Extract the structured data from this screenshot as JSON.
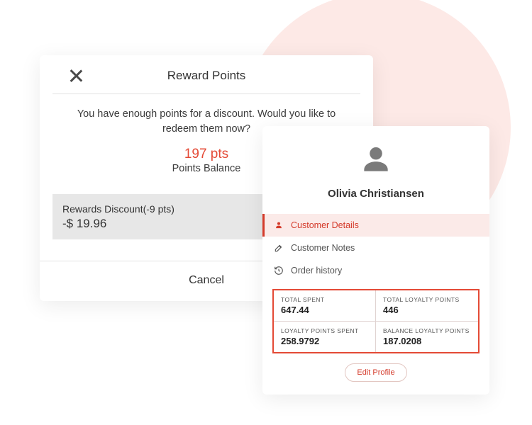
{
  "rewards": {
    "title": "Reward Points",
    "message": "You have enough points for a discount. Would you like to redeem them now?",
    "points_value": "197 pts",
    "points_label": "Points Balance",
    "discount_label": "Rewards Discount(-9 pts)",
    "discount_amount": "-$ 19.96",
    "cancel_label": "Cancel"
  },
  "customer": {
    "name": "Olivia Christiansen",
    "tabs": {
      "details": "Customer Details",
      "notes": "Customer Notes",
      "history": "Order history"
    },
    "stats": {
      "total_spent_label": "TOTAL SPENT",
      "total_spent_value": "647.44",
      "total_points_label": "TOTAL LOYALTY POINTS",
      "total_points_value": "446",
      "points_spent_label": "LOYALTY POINTS SPENT",
      "points_spent_value": "258.9792",
      "balance_points_label": "BALANCE LOYALTY POINTS",
      "balance_points_value": "187.0208"
    },
    "edit_profile": "Edit Profile"
  }
}
